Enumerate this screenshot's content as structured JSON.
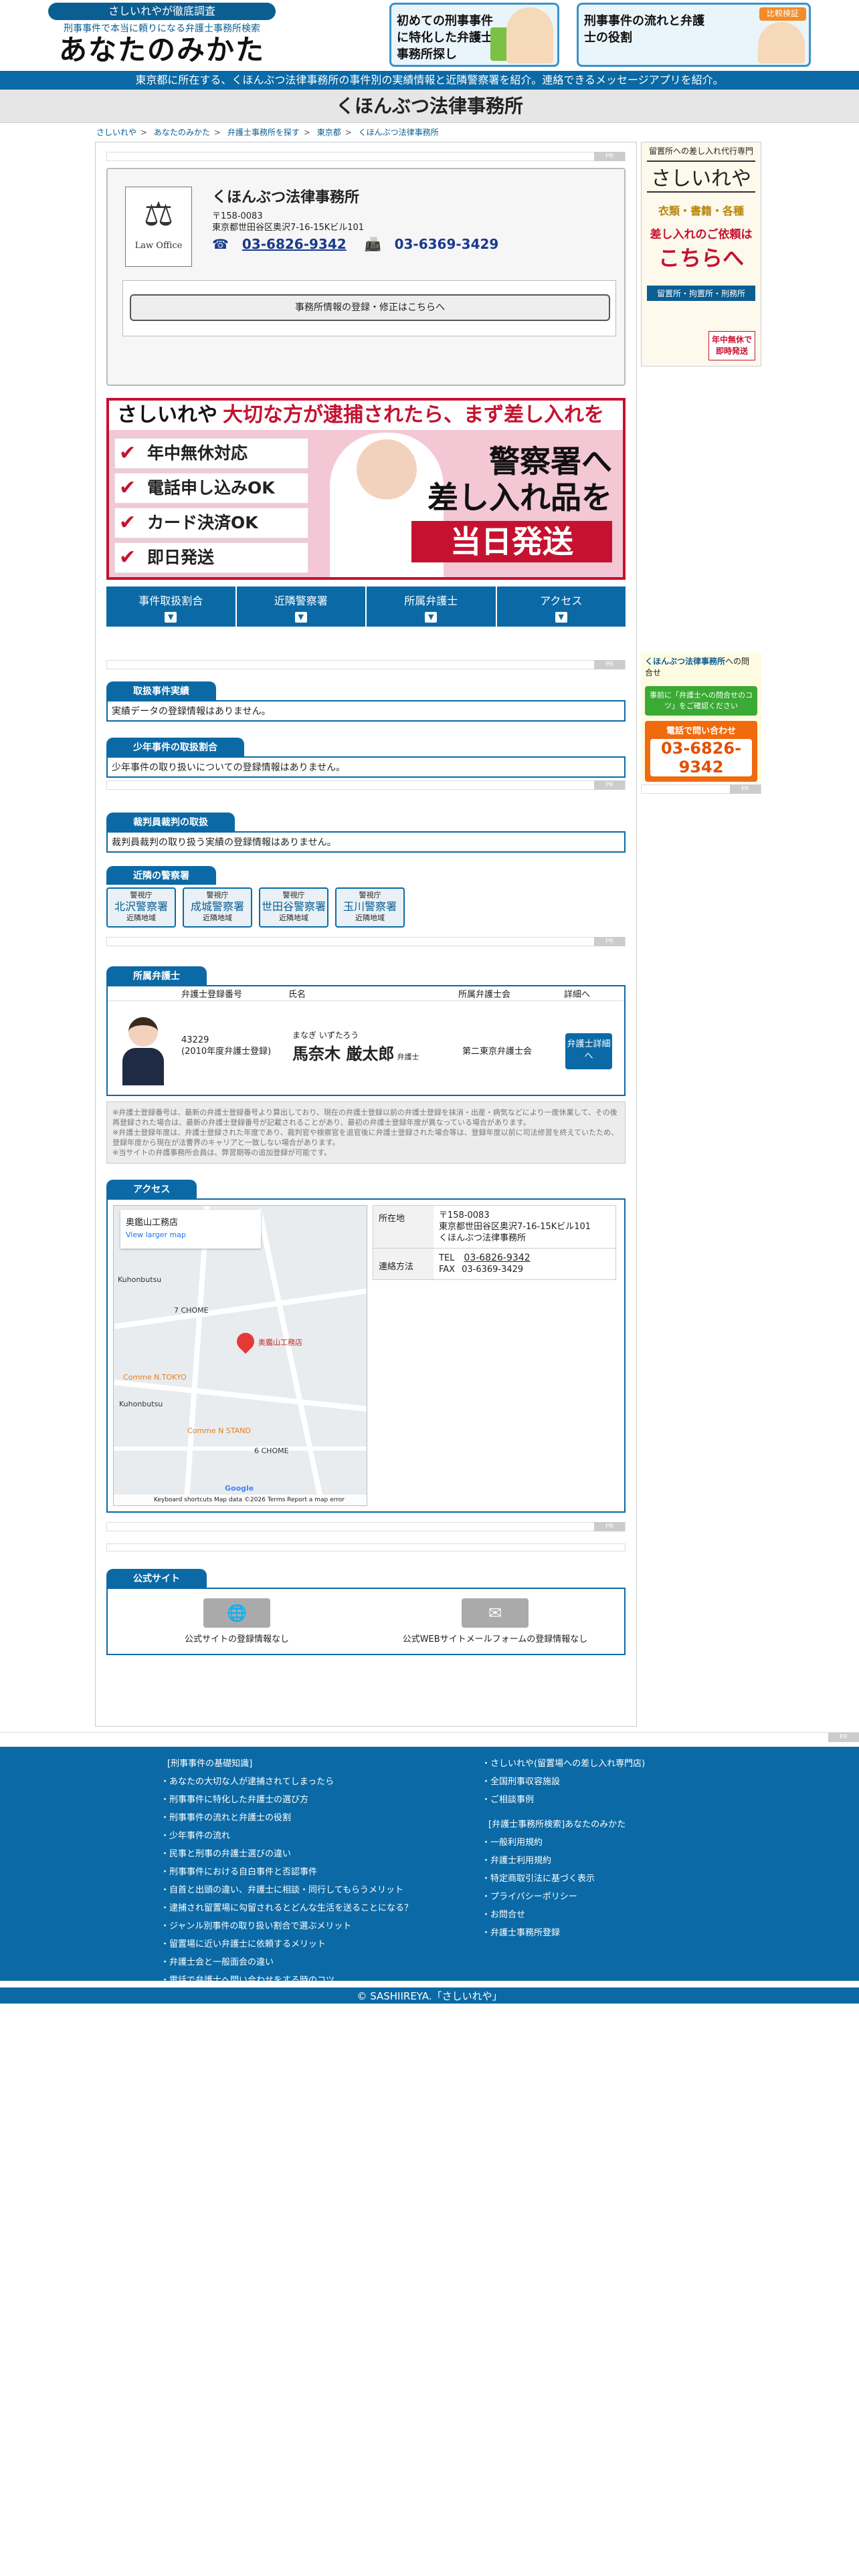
{
  "header": {
    "pill": "さしいれやが徹底調査",
    "tagline": "刑事事件で本当に頼りになる弁護士事務所検索",
    "site_name": "あなたのみかた",
    "banner1": "初めての刑事事件に特化した弁護士事務所探し",
    "banner2": "刑事事件の流れと弁護士の役割",
    "banner2_badge": "比較検証"
  },
  "intro_bar": "東京都に所在する、くほんぶつ法律事務所の事件別の実績情報と近隣警察署を紹介。連絡できるメッセージアプリを紹介。",
  "page_title": "くほんぶつ法律事務所",
  "breadcrumb": [
    "さしいれや",
    "あなたのみかた",
    "弁護士事務所を探す",
    "東京都",
    "くほんぶつ法律事務所"
  ],
  "ad_label": "PR",
  "office": {
    "logo_caption": "Law Office",
    "name": "くほんぶつ法律事務所",
    "postal": "〒158-0083",
    "address": "東京都世田谷区奥沢7-16-15Kビル101",
    "tel": "03-6826-9342",
    "fax": "03-6369-3429",
    "register_button": "事務所情報の登録・修正はこちらへ"
  },
  "ad_banner": {
    "brand": "さしいれや",
    "headline": "大切な方が逮捕されたら、まず差し入れを",
    "items": [
      "年中無休対応",
      "電話申し込みOK",
      "カード決済OK",
      "即日発送"
    ],
    "right1": "警察署へ",
    "right2": "差し入れ品を",
    "right3": "当日発送"
  },
  "tabs": [
    "事件取扱割合",
    "近隣警察署",
    "所属弁護士",
    "アクセス"
  ],
  "tab_arrow": "▼",
  "sections": {
    "results_title": "取扱事件実績",
    "results_text": "実績データの登録情報はありません。",
    "juvenile_title": "少年事件の取扱割合",
    "juvenile_text": "少年事件の取り扱いについての登録情報はありません。",
    "jury_title": "裁判員裁判の取扱",
    "jury_text": "裁判員裁判の取り扱う実績の登録情報はありません。",
    "police_title": "近隣の警察署",
    "lawyers_title": "所属弁護士",
    "access_title": "アクセス",
    "official_title": "公式サイト"
  },
  "police_stations": [
    {
      "org": "警視庁",
      "name": "北沢警察署",
      "tag": "近隣地域"
    },
    {
      "org": "警視庁",
      "name": "成城警察署",
      "tag": "近隣地域"
    },
    {
      "org": "警視庁",
      "name": "世田谷警察署",
      "tag": "近隣地域"
    },
    {
      "org": "警視庁",
      "name": "玉川警察署",
      "tag": "近隣地域"
    }
  ],
  "lawyer_table": {
    "headers": [
      "弁護士登録番号",
      "氏名",
      "所属弁護士会",
      "詳細へ"
    ],
    "lawyer": {
      "reg_no": "43229",
      "reg_year": "(2010年度弁護士登録)",
      "kana": "まなぎ いずたろう",
      "name": "馬奈木 厳太郎",
      "suffix": "弁護士",
      "bar": "第二東京弁護士会",
      "button": "弁護士詳細へ"
    }
  },
  "notes": [
    "※弁護士登録番号は、最新の弁護士登録番号より算出しており、現在の弁護士登録以前の弁護士登録を抹消・出産・病気などにより一度休業して、その後再登録された場合は、最新の弁護士登録番号が記載されることがあり、最初の弁護士登録年度が異なっている場合があります。",
    "※弁護士登録年度は、弁護士登録された年度であり、裁判官や検察官を退官後に弁護士登録された場合等は、登録年度以前に司法修習を終えていたため、登録年度から現在が法曹界のキャリアと一致しない場合があります。",
    "※当サイトの弁護事務所会員は、弊習期等の追加登録が可能です。"
  ],
  "access": {
    "map_place": "奥鑑山工務店",
    "map_link": "View larger map",
    "map_labels": [
      "Kuhonbutsu",
      "7 CHOME",
      "Comme N.TOKYO",
      "Kuhonbutsu",
      "Comme N STAND",
      "6 CHOME",
      "Google"
    ],
    "map_footer": "Keyboard shortcuts   Map data ©2026   Terms   Report a map error",
    "address_label": "所在地",
    "postal": "〒158-0083",
    "address": "東京都世田谷区奥沢7-16-15Kビル101",
    "address_name": "くほんぶつ法律事務所",
    "contact_label": "連絡方法",
    "tel_label": "TEL",
    "tel": "03-6826-9342",
    "fax_label": "FAX",
    "fax": "03-6369-3429"
  },
  "official": {
    "site_text": "公式サイトの登録情報なし",
    "mail_text": "公式WEBサイトメールフォームの登録情報なし"
  },
  "side_ad": {
    "small": "留置所への差し入れ代行専門",
    "brand": "さしいれや",
    "items": "衣類・書籍・各種",
    "request": "差し入れのご依頼は",
    "here": "こちらへ",
    "places": "留置所・拘置所・刑務所",
    "badge": "年中無休で即時発送"
  },
  "side_contact": {
    "name": "くほんぶつ法律事務所",
    "suffix": "への問合せ",
    "note": "事前に「弁護士への問合せのコツ」をご確認ください",
    "phone_label": "電話で問い合わせ",
    "phone": "03-6826-9342"
  },
  "footer": {
    "left_head": "[刑事事件の基礎知識]",
    "left": [
      "あなたの大切な人が逮捕されてしまったら",
      "刑事事件に特化した弁護士の選び方",
      "刑事事件の流れと弁護士の役割",
      "少年事件の流れ",
      "民事と刑事の弁護士選びの違い",
      "刑事事件における自白事件と否認事件",
      "自首と出頭の違い、弁護士に相談・同行してもらうメリット",
      "逮捕され留置場に勾留されるとどんな生活を送ることになる？",
      "ジャンル別事件の取り扱い割合で選ぶメリット",
      "留置場に近い弁護士に依頼するメリット",
      "弁護士会と一般面会の違い",
      "電話で弁護士へ問い合わせをする時のコツ"
    ],
    "right1": [
      "さしいれや(留置場への差し入れ専門店)",
      "全国刑事収容施設",
      "ご相談事例"
    ],
    "right_head": "[弁護士事務所検索]あなたのみかた",
    "right2": [
      "一般利用規約",
      "弁護士利用規約",
      "特定商取引法に基づく表示",
      "プライバシーポリシー",
      "お問合せ",
      "弁護士事務所登録"
    ],
    "copyright": "© SASHIIREYA.「さしいれや」"
  }
}
